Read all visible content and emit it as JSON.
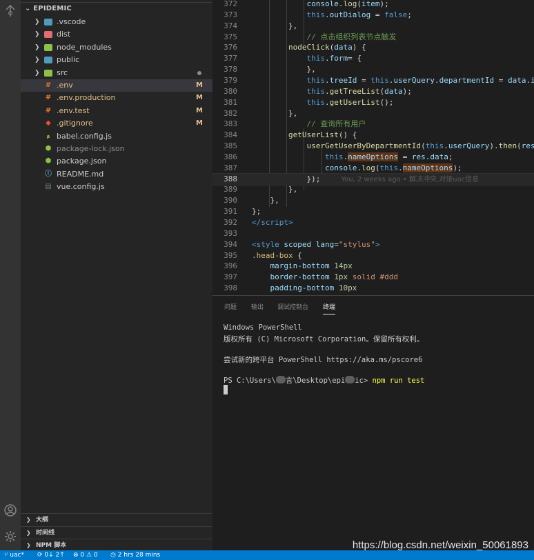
{
  "explorer": {
    "title": "EPIDEMIC",
    "items": [
      {
        "name": ".vscode",
        "type": "folder",
        "color": "#519aba",
        "status": ""
      },
      {
        "name": "dist",
        "type": "folder",
        "color": "#e06c75",
        "status": ""
      },
      {
        "name": "node_modules",
        "type": "folder",
        "color": "#8dc149",
        "status": ""
      },
      {
        "name": "public",
        "type": "folder",
        "color": "#519aba",
        "status": ""
      },
      {
        "name": "src",
        "type": "folder",
        "color": "#8dc149",
        "status": "dot"
      },
      {
        "name": ".env",
        "type": "env",
        "color": "#e37933",
        "status": "M"
      },
      {
        "name": ".env.production",
        "type": "env",
        "color": "#e37933",
        "status": "M"
      },
      {
        "name": ".env.test",
        "type": "env",
        "color": "#e37933",
        "status": "M"
      },
      {
        "name": ".gitignore",
        "type": "git",
        "color": "#f14e32",
        "status": "M"
      },
      {
        "name": "babel.config.js",
        "type": "babel",
        "color": "#cbcb41",
        "status": ""
      },
      {
        "name": "package-lock.json",
        "type": "npm",
        "color": "#8dc149",
        "status": ""
      },
      {
        "name": "package.json",
        "type": "npm",
        "color": "#8dc149",
        "status": ""
      },
      {
        "name": "README.md",
        "type": "info",
        "color": "#519aba",
        "status": ""
      },
      {
        "name": "vue.config.js",
        "type": "config",
        "color": "#6d8086",
        "status": ""
      }
    ],
    "sections": [
      "大纲",
      "时间线",
      "NPM 脚本"
    ]
  },
  "editor": {
    "lines": [
      {
        "n": "372",
        "code": [
          [
            "            ",
            "plain"
          ],
          [
            "console",
            "prop"
          ],
          [
            ".",
            "plain"
          ],
          [
            "log",
            "fn"
          ],
          [
            "(",
            "plain"
          ],
          [
            "item",
            "prop"
          ],
          [
            ");",
            "plain"
          ]
        ]
      },
      {
        "n": "373",
        "code": [
          [
            "            ",
            "plain"
          ],
          [
            "this",
            "kw"
          ],
          [
            ".",
            "plain"
          ],
          [
            "outDialog",
            "prop"
          ],
          [
            " = ",
            "plain"
          ],
          [
            "false",
            "kw"
          ],
          [
            ";",
            "plain"
          ]
        ]
      },
      {
        "n": "374",
        "code": [
          [
            "        },",
            "plain"
          ]
        ]
      },
      {
        "n": "375",
        "code": [
          [
            "            ",
            "plain"
          ],
          [
            "// 点击组织列表节点触发",
            "cm"
          ]
        ]
      },
      {
        "n": "376",
        "code": [
          [
            "        ",
            "plain"
          ],
          [
            "nodeClick",
            "fn"
          ],
          [
            "(",
            "plain"
          ],
          [
            "data",
            "prop"
          ],
          [
            ") {",
            "plain"
          ]
        ]
      },
      {
        "n": "377",
        "code": [
          [
            "            ",
            "plain"
          ],
          [
            "this",
            "kw"
          ],
          [
            ".",
            "plain"
          ],
          [
            "form",
            "prop"
          ],
          [
            "= {",
            "plain"
          ]
        ]
      },
      {
        "n": "378",
        "code": [
          [
            "            },",
            "plain"
          ]
        ]
      },
      {
        "n": "379",
        "code": [
          [
            "            ",
            "plain"
          ],
          [
            "this",
            "kw"
          ],
          [
            ".",
            "plain"
          ],
          [
            "treeId",
            "prop"
          ],
          [
            " = ",
            "plain"
          ],
          [
            "this",
            "kw"
          ],
          [
            ".",
            "plain"
          ],
          [
            "userQuery",
            "prop"
          ],
          [
            ".",
            "plain"
          ],
          [
            "departmentId",
            "prop"
          ],
          [
            " = ",
            "plain"
          ],
          [
            "data",
            "prop"
          ],
          [
            ".",
            "plain"
          ],
          [
            "id",
            "prop"
          ],
          [
            ";",
            "plain"
          ]
        ]
      },
      {
        "n": "380",
        "code": [
          [
            "            ",
            "plain"
          ],
          [
            "this",
            "kw"
          ],
          [
            ".",
            "plain"
          ],
          [
            "getTreeList",
            "fn"
          ],
          [
            "(",
            "plain"
          ],
          [
            "data",
            "prop"
          ],
          [
            ");",
            "plain"
          ]
        ]
      },
      {
        "n": "381",
        "code": [
          [
            "            ",
            "plain"
          ],
          [
            "this",
            "kw"
          ],
          [
            ".",
            "plain"
          ],
          [
            "getUserList",
            "fn"
          ],
          [
            "();",
            "plain"
          ]
        ]
      },
      {
        "n": "382",
        "code": [
          [
            "        },",
            "plain"
          ]
        ]
      },
      {
        "n": "383",
        "code": [
          [
            "            ",
            "plain"
          ],
          [
            "// 查询所有用户",
            "cm"
          ]
        ]
      },
      {
        "n": "384",
        "code": [
          [
            "        ",
            "plain"
          ],
          [
            "getUserList",
            "fn"
          ],
          [
            "() {",
            "plain"
          ]
        ]
      },
      {
        "n": "385",
        "code": [
          [
            "            ",
            "plain"
          ],
          [
            "userGetUserByDepartmentId",
            "fn"
          ],
          [
            "(",
            "plain"
          ],
          [
            "this",
            "kw"
          ],
          [
            ".",
            "plain"
          ],
          [
            "userQuery",
            "prop"
          ],
          [
            ").",
            "plain"
          ],
          [
            "then",
            "fn"
          ],
          [
            "(",
            "plain"
          ],
          [
            "res",
            "prop"
          ],
          [
            " =",
            "plain"
          ]
        ]
      },
      {
        "n": "386",
        "code": [
          [
            "                ",
            "plain"
          ],
          [
            "this",
            "kw"
          ],
          [
            ".",
            "plain"
          ],
          [
            "nameOptions",
            "prop hl"
          ],
          [
            " = ",
            "plain"
          ],
          [
            "res",
            "prop"
          ],
          [
            ".",
            "plain"
          ],
          [
            "data",
            "prop"
          ],
          [
            ";",
            "plain"
          ]
        ]
      },
      {
        "n": "387",
        "code": [
          [
            "                ",
            "plain"
          ],
          [
            "console",
            "prop"
          ],
          [
            ".",
            "plain"
          ],
          [
            "log",
            "fn"
          ],
          [
            "(",
            "plain"
          ],
          [
            "this",
            "kw"
          ],
          [
            ".",
            "plain"
          ],
          [
            "nameOptions",
            "prop hl"
          ],
          [
            ");",
            "plain"
          ]
        ]
      },
      {
        "n": "388",
        "code": [
          [
            "            });",
            "plain"
          ]
        ],
        "blame": "You, 2 weeks ago • 解决冲突,对接uac信息"
      },
      {
        "n": "389",
        "code": [
          [
            "        },",
            "plain"
          ]
        ]
      },
      {
        "n": "390",
        "code": [
          [
            "    },",
            "plain"
          ]
        ]
      },
      {
        "n": "391",
        "code": [
          [
            "};",
            "plain"
          ]
        ]
      },
      {
        "n": "392",
        "code": [
          [
            "</",
            "tag"
          ],
          [
            "script",
            "tag"
          ],
          [
            ">",
            "tag"
          ]
        ]
      },
      {
        "n": "393",
        "code": [
          [
            "",
            "plain"
          ]
        ]
      },
      {
        "n": "394",
        "code": [
          [
            "<",
            "tag"
          ],
          [
            "style",
            "tag"
          ],
          [
            " ",
            "plain"
          ],
          [
            "scoped",
            "attr"
          ],
          [
            " ",
            "plain"
          ],
          [
            "lang",
            "attr"
          ],
          [
            "=",
            "plain"
          ],
          [
            "\"stylus\"",
            "str"
          ],
          [
            ">",
            "tag"
          ]
        ]
      },
      {
        "n": "395",
        "code": [
          [
            ".head-box",
            "sel-c"
          ],
          [
            " {",
            "plain"
          ]
        ]
      },
      {
        "n": "396",
        "code": [
          [
            "    ",
            "plain"
          ],
          [
            "margin-bottom",
            "css-p"
          ],
          [
            " ",
            "plain"
          ],
          [
            "14px",
            "num"
          ]
        ]
      },
      {
        "n": "397",
        "code": [
          [
            "    ",
            "plain"
          ],
          [
            "border-bottom",
            "css-p"
          ],
          [
            " ",
            "plain"
          ],
          [
            "1px",
            "num"
          ],
          [
            " ",
            "plain"
          ],
          [
            "solid",
            "str"
          ],
          [
            " ",
            "plain"
          ],
          [
            "#ddd",
            "str"
          ]
        ]
      },
      {
        "n": "398",
        "code": [
          [
            "    ",
            "plain"
          ],
          [
            "padding-bottom",
            "css-p"
          ],
          [
            " ",
            "plain"
          ],
          [
            "10px",
            "num"
          ]
        ]
      }
    ],
    "current_line": "388"
  },
  "panel": {
    "tabs": [
      "问题",
      "输出",
      "调试控制台",
      "终端"
    ],
    "active_tab": "终端",
    "terminal": {
      "line1": "Windows PowerShell",
      "line2": "版权所有 (C) Microsoft Corporation。保留所有权利。",
      "line3": "尝试新的跨平台 PowerShell https://aka.ms/pscore6",
      "prompt_a": "PS C:\\Users\\",
      "prompt_b": "言\\Desktop\\epi",
      "prompt_c": "ic> ",
      "command": "npm run test"
    }
  },
  "watermark": "https://blog.csdn.net/weixin_50061893",
  "statusbar": {
    "branch": "uac*",
    "sync": "0↓ 2↑",
    "problems": "⊗ 0 ⚠ 0",
    "time": "2 hrs 28 mins"
  }
}
